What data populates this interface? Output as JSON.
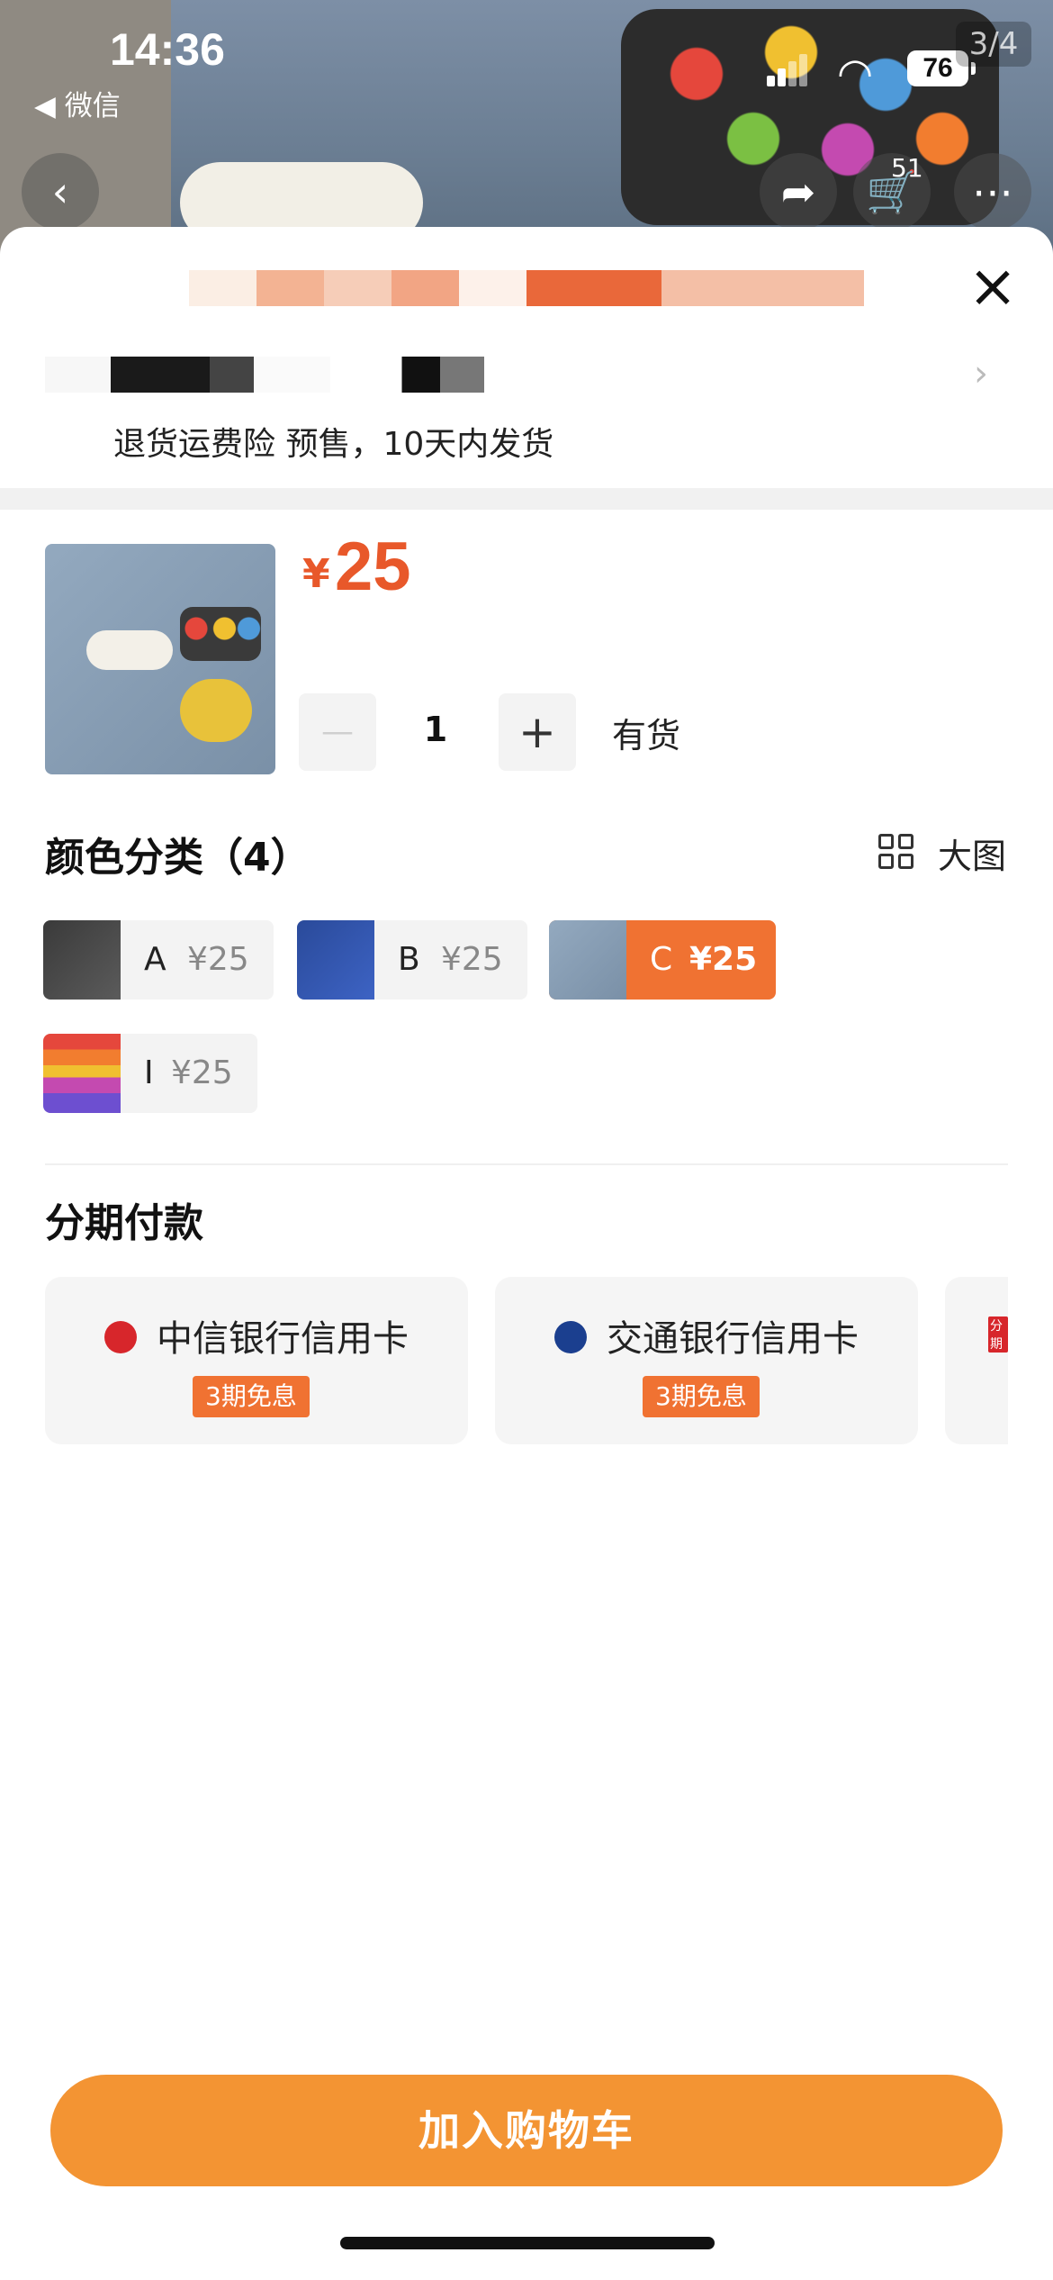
{
  "status_bar": {
    "time": "14:36",
    "back_app": "◀ 微信",
    "battery": "76"
  },
  "gallery": {
    "pager": "3/4",
    "cart_count": "51"
  },
  "service": {
    "text": "退货运费险 预售，10天内发货"
  },
  "product": {
    "currency": "¥",
    "price": "25",
    "quantity": "1",
    "minus": "—",
    "plus": "+",
    "stock": "有货"
  },
  "color_section": {
    "title": "颜色分类（4）",
    "big_view": "大图",
    "options": [
      {
        "label": "A",
        "price": "¥25",
        "selected": false
      },
      {
        "label": "B",
        "price": "¥25",
        "selected": false
      },
      {
        "label": "C",
        "price": "¥25",
        "selected": true
      },
      {
        "label": "I",
        "price": "¥25",
        "selected": false
      }
    ]
  },
  "installment": {
    "title": "分期付款",
    "cards": [
      {
        "bank": "中信银行信用卡",
        "tag": "3期免息",
        "logo_color": "#d7262b"
      },
      {
        "bank": "交通银行信用卡",
        "tag": "3期免息",
        "logo_color": "#1b3f8f"
      },
      {
        "bank": "分期",
        "tag": ""
      }
    ]
  },
  "cta": {
    "label": "加入购物车"
  },
  "colors": {
    "accent": "#f07232",
    "price": "#e8582a",
    "cta": "#f39433"
  }
}
